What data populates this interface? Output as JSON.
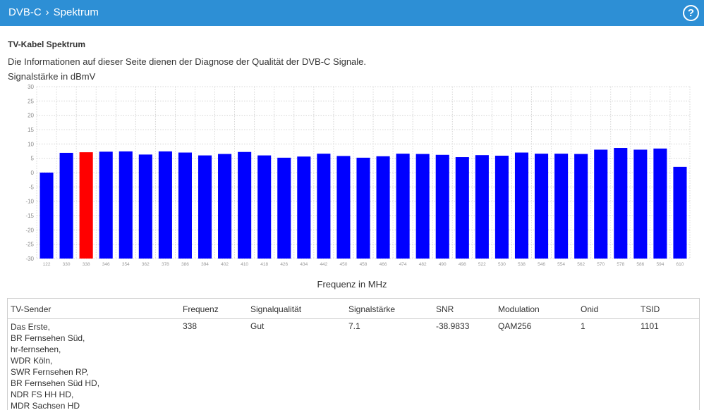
{
  "header": {
    "crumb_root": "DVB-C",
    "crumb_current": "Spektrum",
    "help_label": "?"
  },
  "page": {
    "title": "TV-Kabel Spektrum",
    "intro": "Die Informationen auf dieser Seite dienen der Diagnose der Qualität der DVB-C Signale.",
    "chart_caption": "Signalstärke in dBmV"
  },
  "chart_data": {
    "type": "bar",
    "xlabel": "Frequenz in MHz",
    "ylabel": "Signalstärke in dBmV",
    "ylim": [
      -30,
      30
    ],
    "yticks": [
      "30",
      "25",
      "20",
      "15",
      "10",
      "5",
      "0",
      "-5",
      "-10",
      "-15",
      "-20",
      "-25",
      "-30"
    ],
    "grid": true,
    "colors": {
      "default": "#0000ff",
      "selected": "#ff0000",
      "grid": "#cccccc"
    },
    "selected_index": 2,
    "categories": [
      "122",
      "330",
      "338",
      "346",
      "354",
      "362",
      "378",
      "386",
      "394",
      "402",
      "410",
      "418",
      "426",
      "434",
      "442",
      "450",
      "458",
      "466",
      "474",
      "482",
      "490",
      "498",
      "522",
      "530",
      "538",
      "546",
      "554",
      "562",
      "570",
      "578",
      "586",
      "594",
      "610"
    ],
    "values": [
      -1.8,
      6.9,
      7.1,
      7.3,
      7.4,
      6.3,
      7.4,
      7.0,
      6.0,
      6.5,
      7.2,
      6.0,
      5.2,
      5.6,
      6.6,
      5.8,
      5.2,
      5.7,
      6.6,
      6.5,
      6.2,
      5.4,
      6.1,
      5.9,
      7.0,
      6.6,
      6.6,
      6.5,
      8.0,
      8.6,
      8.0,
      8.4,
      2.0
    ]
  },
  "table": {
    "headers": {
      "sender": "TV-Sender",
      "freq": "Frequenz",
      "quality": "Signalqualität",
      "strength": "Signalstärke",
      "snr": "SNR",
      "modulation": "Modulation",
      "onid": "Onid",
      "tsid": "TSID"
    },
    "row": {
      "senders": [
        "Das Erste,",
        "BR Fernsehen Süd,",
        "hr-fernsehen,",
        "WDR Köln,",
        "SWR Fernsehen RP,",
        "BR Fernsehen Süd HD,",
        "NDR FS HH HD,",
        "MDR Sachsen HD"
      ],
      "freq": "338",
      "quality": "Gut",
      "strength": "7.1",
      "snr": "-38.9833",
      "modulation": "QAM256",
      "onid": "1",
      "tsid": "1101"
    }
  }
}
